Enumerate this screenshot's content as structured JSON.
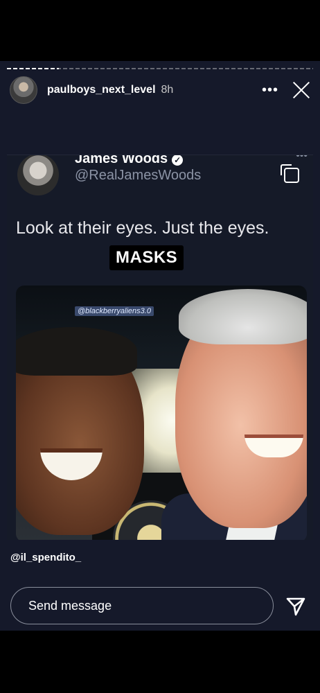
{
  "story": {
    "username": "paulboys_next_level",
    "time": "8h",
    "more_label": "•••",
    "credit": "@il_spendito_",
    "message_placeholder": "Send message"
  },
  "tweet": {
    "name": "James Woods",
    "handle": "@RealJamesWoods",
    "more_label": "•••",
    "text": "Look at their eyes. Just the eyes.",
    "overlay": "MASKS",
    "image_watermark": "@blackberryaliens3.0"
  },
  "colors": {
    "background": "#15192a",
    "handle": "#8b93a5"
  },
  "progress_fraction": 0.17
}
